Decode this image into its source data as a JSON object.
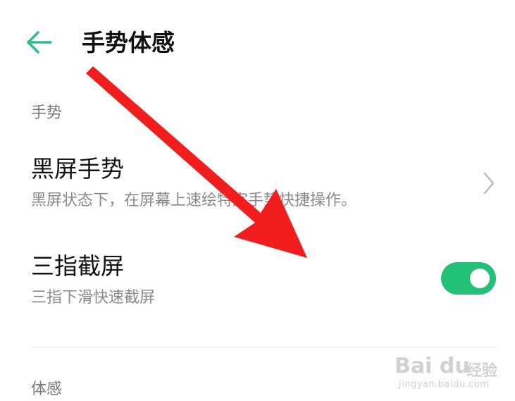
{
  "header": {
    "back_icon": "arrow-left-icon",
    "title": "手势体感"
  },
  "sections": [
    {
      "label": "手势"
    },
    {
      "label": "体感"
    }
  ],
  "rows": [
    {
      "title": "黑屏手势",
      "subtitle": "黑屏状态下，在屏幕上速绘特定手势快捷操作。",
      "trailing_icon": "chevron-right-icon"
    },
    {
      "title": "三指截屏",
      "subtitle": "三指下滑快速截屏",
      "toggle_on": true
    }
  ],
  "watermark": {
    "logo": "Bai du",
    "text": "经验",
    "url": "jingyan.baidu.com"
  },
  "colors": {
    "accent": "#22c177",
    "back_arrow": "#2bbf8a",
    "annotation_arrow": "#f21d1d"
  }
}
